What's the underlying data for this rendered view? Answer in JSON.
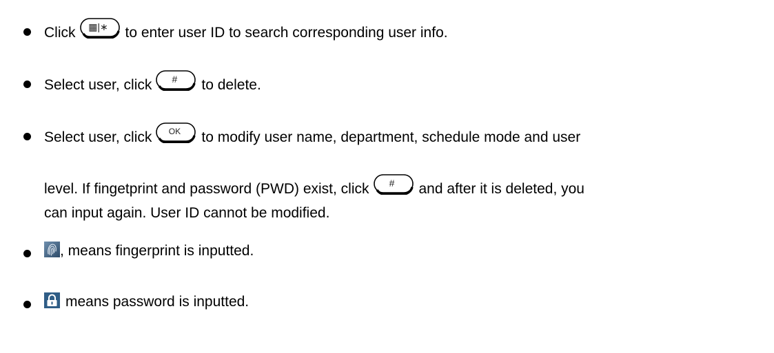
{
  "items": [
    {
      "before": "Click",
      "key": "▦|∗",
      "after": "to enter user ID to search corresponding user info."
    },
    {
      "before": "Select user, click",
      "key": "#",
      "after": "to delete."
    },
    {
      "before": "Select user, click",
      "key": "OK",
      "after": "to modify user name, department, schedule mode and user",
      "line2_before": "level. If fingetprint and password (PWD) exist, click",
      "line2_key": "#",
      "line2_after": "and after it is deleted, you",
      "line3": "can input again. User ID cannot be modified."
    },
    {
      "icon": "fingerprint-icon",
      "after": ", means fingerprint is inputted."
    },
    {
      "icon": "padlock-icon",
      "after": "means password is inputted."
    }
  ]
}
